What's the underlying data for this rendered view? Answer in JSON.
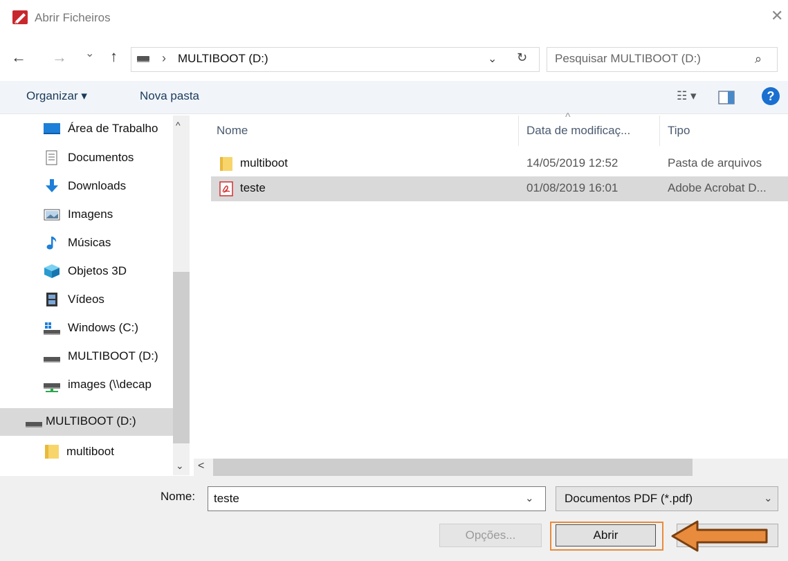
{
  "window": {
    "title": "Abrir Ficheiros",
    "close_glyph": "✕"
  },
  "nav": {
    "back_glyph": "←",
    "forward_glyph": "→",
    "recent_glyph": "⌄",
    "up_glyph": "↑",
    "address_sep": "›",
    "address_path": "MULTIBOOT (D:)",
    "address_dropdown_glyph": "⌄",
    "refresh_glyph": "↻",
    "search_placeholder": "Pesquisar MULTIBOOT (D:)",
    "search_glyph": "⌕"
  },
  "toolbar": {
    "organize_label": "Organizar ▾",
    "new_folder_label": "Nova pasta",
    "view_glyph": "☷ ▾",
    "help_glyph": "?"
  },
  "tree": {
    "items": [
      {
        "label": "Área de Trabalho",
        "icon": "desktop-icon"
      },
      {
        "label": "Documentos",
        "icon": "document-icon"
      },
      {
        "label": "Downloads",
        "icon": "download-icon"
      },
      {
        "label": "Imagens",
        "icon": "image-icon"
      },
      {
        "label": "Músicas",
        "icon": "music-icon"
      },
      {
        "label": "Objetos 3D",
        "icon": "cube-icon"
      },
      {
        "label": "Vídeos",
        "icon": "video-icon"
      },
      {
        "label": "Windows (C:)",
        "icon": "windows-drive-icon"
      },
      {
        "label": "MULTIBOOT (D:)",
        "icon": "drive-icon"
      },
      {
        "label": "images (\\\\decap",
        "icon": "network-drive-icon"
      },
      {
        "label": "MULTIBOOT (D:)",
        "icon": "drive-icon"
      },
      {
        "label": "multiboot",
        "icon": "folder-icon"
      }
    ],
    "up_glyph": "^",
    "down_glyph": "⌄"
  },
  "list": {
    "columns": {
      "name": "Nome",
      "date": "Data de modificaç...",
      "type": "Tipo"
    },
    "sort_glyph": "^",
    "rows": [
      {
        "name": "multiboot",
        "date": "14/05/2019 12:52",
        "type": "Pasta de arquivos",
        "icon": "folder-icon"
      },
      {
        "name": "teste",
        "date": "01/08/2019 16:01",
        "type": "Adobe Acrobat D...",
        "icon": "pdf-icon"
      }
    ],
    "hscroll_left_glyph": "<"
  },
  "footer": {
    "name_label": "Nome:",
    "name_value": "teste",
    "name_dropdown_glyph": "⌄",
    "filter_value": "Documentos PDF (*.pdf)",
    "filter_dropdown_glyph": "⌄",
    "options_label": "Opções...",
    "open_label": "Abrir"
  },
  "colors": {
    "accent": "#1a6fd0",
    "highlight_arrow": "#e88b3c",
    "selection": "#d9d9d9"
  }
}
